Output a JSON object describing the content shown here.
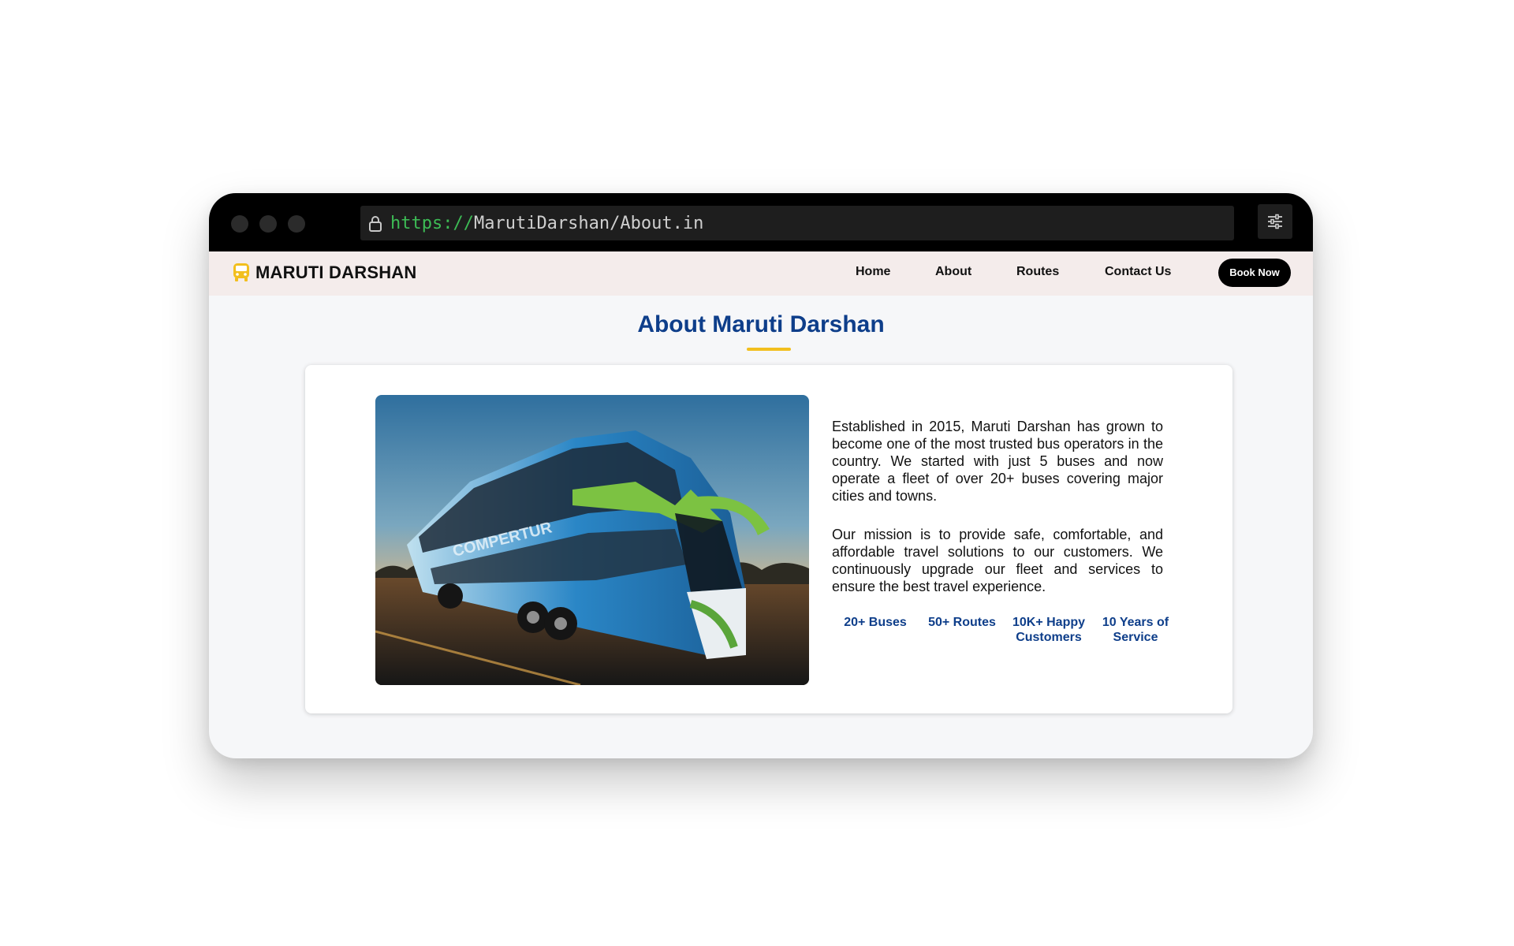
{
  "browser": {
    "url_scheme": "https://",
    "url_path": "MarutiDarshan/About.in"
  },
  "navbar": {
    "brand": "MARUTI DARSHAN",
    "brand_icon": "bus-icon",
    "links": [
      "Home",
      "About",
      "Routes",
      "Contact Us"
    ],
    "cta": "Book Now"
  },
  "about": {
    "title": "About Maruti Darshan",
    "paragraphs": [
      "Established in 2015, Maruti Darshan has grown to become one of the most trusted bus operators in the country. We started with just 5 buses and now operate a fleet of over 20+ buses covering major cities and towns.",
      "Our mission is to provide safe, comfortable, and affordable travel solutions to our customers. We continuously upgrade our fleet and services to ensure the best travel experience."
    ],
    "stats": [
      "20+ Buses",
      "50+ Routes",
      "10K+ Happy Customers",
      "10 Years of Service"
    ],
    "image_text": "COMPERTUR"
  },
  "colors": {
    "title_blue": "#0e3e8a",
    "accent_yellow": "#f2bf1e",
    "navbar_bg": "#f4eceb",
    "url_scheme_green": "#3dbb55"
  }
}
